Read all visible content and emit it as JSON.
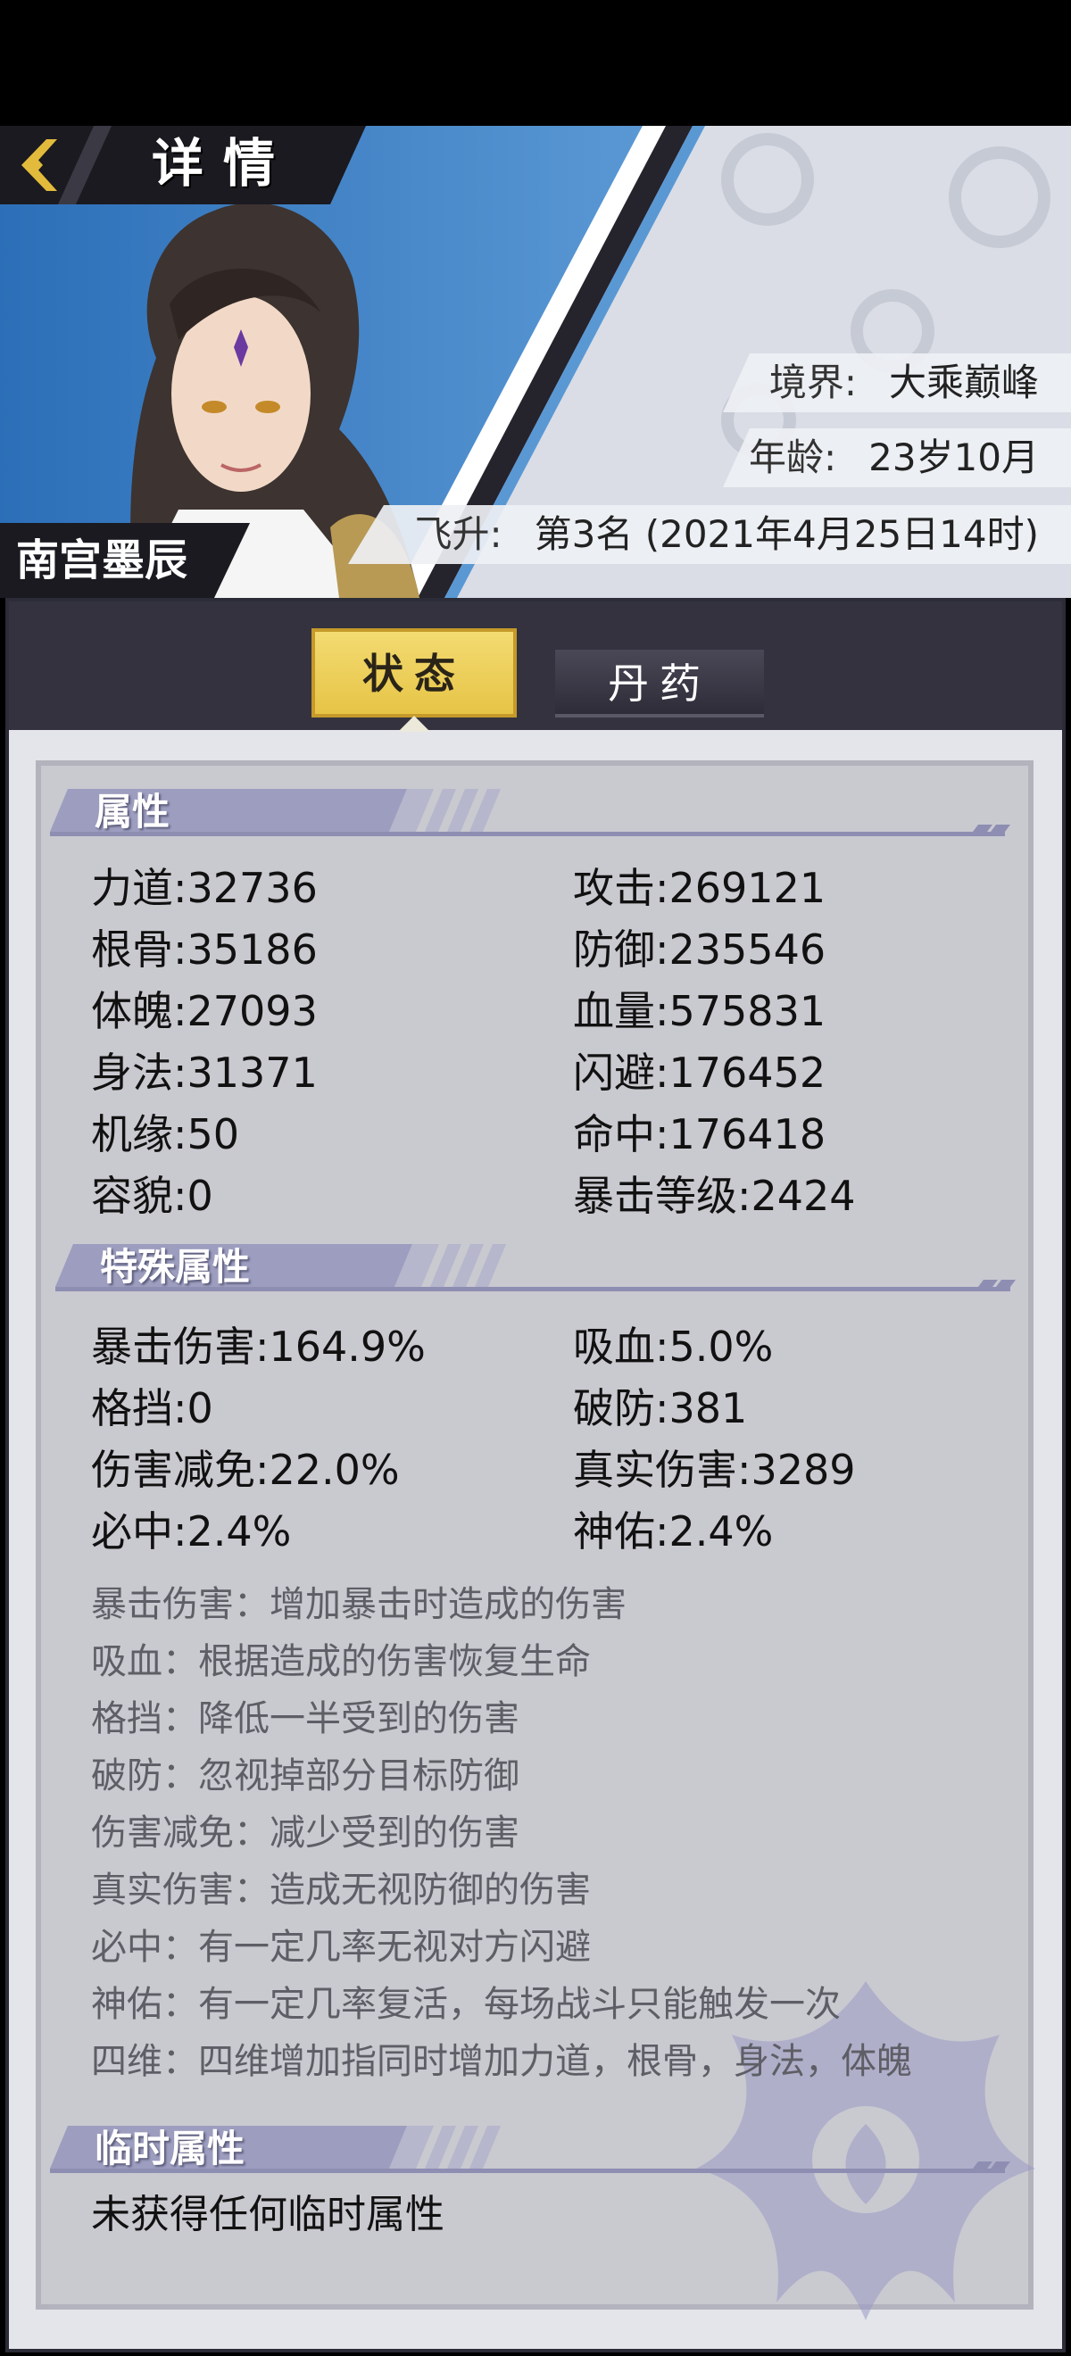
{
  "header": {
    "title": "详情",
    "character_name": "南宫墨辰",
    "info": [
      {
        "label": "境界:",
        "value": "大乘巅峰"
      },
      {
        "label": "年龄:",
        "value": "23岁10月"
      },
      {
        "label": "飞升:",
        "value": "第3名 (2021年4月25日14时)"
      }
    ]
  },
  "tabs": [
    {
      "label": "状态",
      "active": true
    },
    {
      "label": "丹药",
      "active": false
    }
  ],
  "sections": {
    "attributes": {
      "title": "属性",
      "left": [
        "力道:32736",
        "根骨:35186",
        "体魄:27093",
        "身法:31371",
        "机缘:50",
        "容貌:0"
      ],
      "right": [
        "攻击:269121",
        "防御:235546",
        "血量:575831",
        "闪避:176452",
        "命中:176418",
        "暴击等级:2424"
      ]
    },
    "special": {
      "title": "特殊属性",
      "left": [
        "暴击伤害:164.9%",
        "格挡:0",
        "伤害减免:22.0%",
        "必中:2.4%"
      ],
      "right": [
        "吸血:5.0%",
        "破防:381",
        "真实伤害:3289",
        "神佑:2.4%"
      ],
      "descriptions": [
        "暴击伤害：增加暴击时造成的伤害",
        "吸血：根据造成的伤害恢复生命",
        "格挡：降低一半受到的伤害",
        "破防：忽视掉部分目标防御",
        "伤害减免：减少受到的伤害",
        "真实伤害：造成无视防御的伤害",
        "必中：有一定几率无视对方闪避",
        "神佑：有一定几率复活，每场战斗只能触发一次",
        "四维：四维增加指同时增加力道，根骨，身法，体魄"
      ]
    },
    "temporary": {
      "title": "临时属性",
      "empty_text": "未获得任何临时属性"
    }
  },
  "colors": {
    "accent_gold": "#e6c446",
    "panel_dark": "#34323f",
    "card_bg": "#c9c9d0",
    "section_bar": "#9b9bbd"
  },
  "icons": [
    "back-chevron-icon",
    "character-portrait",
    "emblem-watermark-icon"
  ]
}
